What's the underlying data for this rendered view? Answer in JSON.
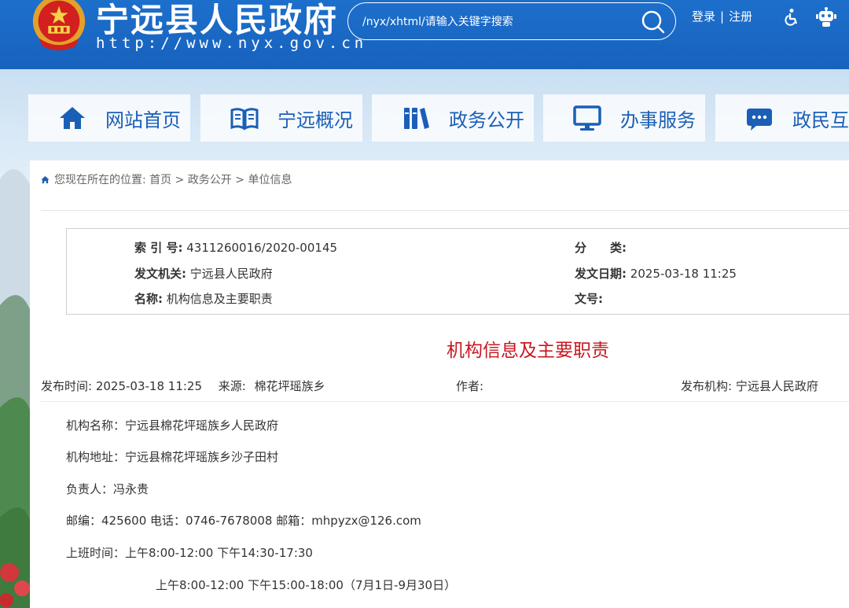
{
  "header": {
    "title": "宁远县人民政府",
    "url": "http://www.nyx.gov.cn",
    "search_placeholder": "/nyx/xhtml/请输入关键字搜索",
    "login": "登录",
    "separator": "|",
    "register": "注册",
    "icons": [
      "national-emblem",
      "search-icon",
      "accessibility-icon",
      "robot-icon"
    ]
  },
  "nav": {
    "items": [
      {
        "label": "网站首页",
        "icon": "home-icon"
      },
      {
        "label": "宁远概况",
        "icon": "book-icon"
      },
      {
        "label": "政务公开",
        "icon": "files-icon"
      },
      {
        "label": "办事服务",
        "icon": "monitor-icon"
      },
      {
        "label": "政民互动",
        "icon": "chat-icon"
      }
    ]
  },
  "breadcrumb": {
    "prefix": "您现在所在的位置:",
    "items": [
      "首页",
      "政务公开",
      "单位信息"
    ],
    "sep": ">"
  },
  "meta": {
    "index_label": "索 引 号:",
    "index_value": "4311260016/2020-00145",
    "category_label": "分　　类:",
    "category_value": "",
    "issuer_label": "发文机关:",
    "issuer_value": "宁远县人民政府",
    "date_label": "发文日期:",
    "date_value": "2025-03-18 11:25",
    "name_label": "名称:",
    "name_value": "机构信息及主要职责",
    "docno_label": "文号:",
    "docno_value": ""
  },
  "article": {
    "title": "机构信息及主要职责",
    "publish_time_label": "发布时间:",
    "publish_time": "2025-03-18 11:25",
    "source_label": "来源:",
    "source": "棉花坪瑶族乡",
    "author_label": "作者:",
    "author": "",
    "org_label": "发布机构:",
    "org": "宁远县人民政府",
    "lines": [
      "机构名称：宁远县棉花坪瑶族乡人民政府",
      "机构地址：宁远县棉花坪瑶族乡沙子田村",
      "负责人：冯永贵",
      "邮编：425600 电话：0746-7678008 邮箱：mhpyzx@126.com",
      "上班时间：上午8:00-12:00  下午14:30-17:30",
      "上午8:00-12:00  下午15:00-18:00（7月1日-9月30日）"
    ]
  },
  "colors": {
    "header_blue": "#1d6fcc",
    "nav_text": "#1a5fb6",
    "title_red": "#c8171f"
  }
}
